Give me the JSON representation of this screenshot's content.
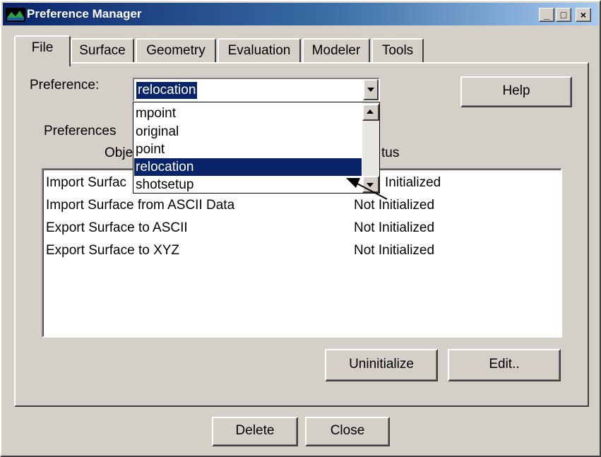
{
  "window": {
    "title": "Preference Manager"
  },
  "title_buttons": {
    "minimize": "_",
    "maximize": "□",
    "close": "×"
  },
  "tabs": [
    {
      "label": "File",
      "active": true
    },
    {
      "label": "Surface",
      "active": false
    },
    {
      "label": "Geometry",
      "active": false
    },
    {
      "label": "Evaluation",
      "active": false
    },
    {
      "label": "Modeler",
      "active": false
    },
    {
      "label": "Tools",
      "active": false
    }
  ],
  "preference": {
    "label": "Preference:",
    "selected": "relocation",
    "options": [
      "mpoint",
      "original",
      "point",
      "relocation",
      "shotsetup"
    ]
  },
  "help_button": "Help",
  "preferences_group": {
    "title": "Preferences",
    "col_object_partial": "Obje",
    "col_status_partial": "tus",
    "rows": [
      {
        "object": "Import Surfac",
        "status": "Initialized"
      },
      {
        "object": "Import Surface from ASCII Data",
        "status": "Not Initialized"
      },
      {
        "object": "Export Surface to ASCII",
        "status": "Not Initialized"
      },
      {
        "object": "Export Surface to  XYZ",
        "status": "Not Initialized"
      }
    ]
  },
  "buttons": {
    "uninitialize": "Uninitialize",
    "edit": "Edit..",
    "delete": "Delete",
    "close": "Close"
  },
  "colors": {
    "titlebar_start": "#0a246a",
    "titlebar_end": "#a6caf0",
    "selection": "#0a246a",
    "face": "#d4d0c8"
  }
}
